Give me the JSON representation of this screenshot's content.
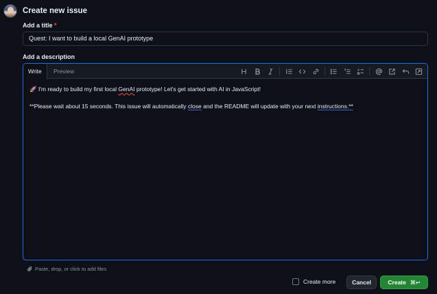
{
  "header": {
    "title": "Create new issue"
  },
  "title_field": {
    "label": "Add a title",
    "required_mark": "*",
    "value": "Quest: I want to build a local GenAI prototype"
  },
  "description": {
    "label": "Add a description",
    "tabs": [
      {
        "label": "Write"
      },
      {
        "label": "Preview"
      }
    ],
    "line1": {
      "before": "🚀 I'm ready to build my first local ",
      "err": "GenAI",
      "after": " prototype! Let's get started with AI in JavaScript!"
    },
    "line2": {
      "before": "**Please wait about 15 seconds. This issue will automatically ",
      "err1": "close",
      "mid": " and the README will update with your next ",
      "err2": "instructions.**"
    }
  },
  "attach_hint": "Paste, drop, or click to add files",
  "footer": {
    "create_more_label": "Create more",
    "cancel_label": "Cancel",
    "create_label": "Create",
    "create_shortcut": "⌘↩"
  },
  "toolbar_icons": [
    "heading-icon",
    "bold-icon",
    "italic-icon",
    "quote-icon",
    "code-icon",
    "link-icon",
    "unordered-list-icon",
    "ordered-list-icon",
    "task-list-icon",
    "mention-icon",
    "cross-reference-icon",
    "undo-icon",
    "fullscreen-icon"
  ]
}
